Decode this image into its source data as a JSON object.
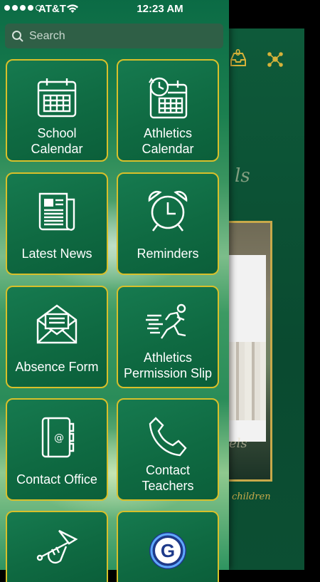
{
  "status_bar": {
    "carrier": "AT&T",
    "time": "12:23 AM"
  },
  "search": {
    "placeholder": "Search"
  },
  "menu": {
    "school_calendar": {
      "label_line1": "School",
      "label_line2": "Calendar",
      "icon": "calendar-icon"
    },
    "athletics_calendar": {
      "label_line1": "Athletics",
      "label_line2": "Calendar",
      "icon": "calendar-clock-icon"
    },
    "latest_news": {
      "label": "Latest News",
      "icon": "newspaper-icon"
    },
    "reminders": {
      "label": "Reminders",
      "icon": "alarm-clock-icon"
    },
    "absence_form": {
      "label": "Absence Form",
      "icon": "envelope-icon"
    },
    "athletics_permission": {
      "label_line1": "Athletics",
      "label_line2": "Permission Slip",
      "icon": "runner-icon"
    },
    "contact_office": {
      "label": "Contact Office",
      "icon": "address-book-icon"
    },
    "contact_teachers": {
      "label_line1": "Contact",
      "label_line2": "Teachers",
      "icon": "phone-icon"
    },
    "partial_1": {
      "icon": "trumpet-icon"
    },
    "partial_2": {
      "icon": "g-logo-icon"
    }
  },
  "background_app": {
    "badge_count": "0",
    "script_text_1": "ls",
    "script_text_2": "els",
    "script_text_3": "children"
  },
  "colors": {
    "tile_border": "#d8c02a",
    "tile_fill": "#0f6a42",
    "accent_gold": "#c8a94a"
  }
}
